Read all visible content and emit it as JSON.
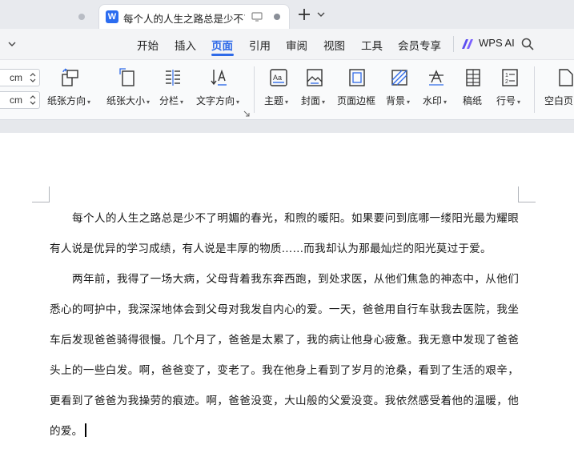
{
  "tabs": {
    "active_title": "每个人的人生之路总是少不了明媚的春光，和煦的暖阳。",
    "logo_letter": "W"
  },
  "menu": {
    "items": [
      "开始",
      "插入",
      "页面",
      "引用",
      "审阅",
      "视图",
      "工具",
      "会员专享"
    ],
    "active": "页面",
    "wps_ai": "WPS AI"
  },
  "ribbon": {
    "units": [
      "cm",
      "cm"
    ],
    "buttons": [
      {
        "label": "纸张方向",
        "icon": "paper-orientation-icon",
        "dropdown": true
      },
      {
        "label": "纸张大小",
        "icon": "paper-size-icon",
        "dropdown": true
      },
      {
        "label": "分栏",
        "icon": "columns-icon",
        "dropdown": true
      },
      {
        "label": "文字方向",
        "icon": "text-direction-icon",
        "dropdown": true
      },
      {
        "label": "主题",
        "icon": "theme-icon",
        "dropdown": true
      },
      {
        "label": "封面",
        "icon": "cover-icon",
        "dropdown": true
      },
      {
        "label": "页面边框",
        "icon": "page-border-icon",
        "dropdown": false
      },
      {
        "label": "背景",
        "icon": "background-icon",
        "dropdown": true
      },
      {
        "label": "水印",
        "icon": "watermark-icon",
        "dropdown": true
      },
      {
        "label": "稿纸",
        "icon": "manuscript-paper-icon",
        "dropdown": false
      },
      {
        "label": "行号",
        "icon": "line-number-icon",
        "dropdown": true
      },
      {
        "label": "空白页",
        "icon": "blank-page-icon",
        "dropdown": false
      }
    ]
  },
  "document": {
    "paragraphs": [
      "每个人的人生之路总是少不了明媚的春光，和煦的暖阳。如果要问到底哪一缕阳光最为耀眼有人说是优异的学习成绩，有人说是丰厚的物质……而我却认为那最灿烂的阳光莫过于爱。",
      "两年前，我得了一场大病，父母背着我东奔西跑，到处求医，从他们焦急的神态中，从他们悉心的呵护中，我深深地体会到父母对我发自内心的爱。一天，爸爸用自行车驮我去医院，我坐车后发现爸爸骑得很慢。几个月了，爸爸是太累了，我的病让他身心疲惫。我无意中发现了爸爸头上的一些白发。啊，爸爸变了，变老了。我在他身上看到了岁月的沧桑，看到了生活的艰辛，更看到了爸爸为我操劳的痕迹。啊，爸爸没变，大山般的父爱没变。我依然感受着他的温暖，他的爱。"
    ]
  },
  "colors": {
    "accent": "#2f6ae8",
    "logo": "#2b6cf0"
  }
}
